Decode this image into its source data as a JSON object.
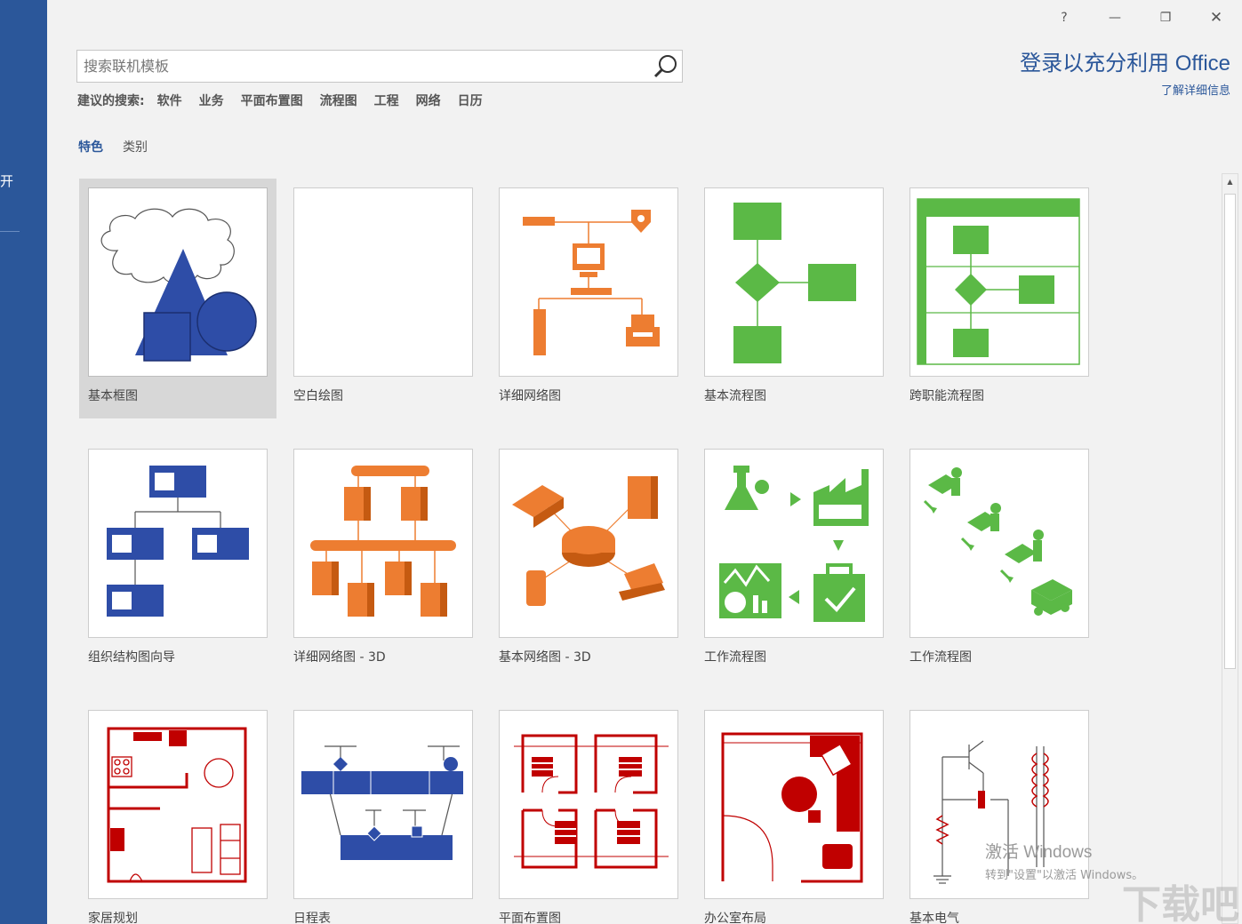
{
  "sidebar": {
    "partial_item": "开"
  },
  "window_controls": {
    "help": "?",
    "minimize": "—",
    "restore": "❐",
    "close": "✕"
  },
  "signin": {
    "title": "登录以充分利用 Office",
    "more": "了解详细信息"
  },
  "search": {
    "placeholder": "搜索联机模板"
  },
  "suggested": {
    "label": "建议的搜索:",
    "items": [
      "软件",
      "业务",
      "平面布置图",
      "流程图",
      "工程",
      "网络",
      "日历"
    ]
  },
  "tabs": [
    {
      "label": "特色",
      "active": true
    },
    {
      "label": "类别",
      "active": false
    }
  ],
  "templates": [
    {
      "label": "基本框图",
      "icon": "basic-shapes-icon",
      "selected": true
    },
    {
      "label": "空白绘图",
      "icon": "blank-icon"
    },
    {
      "label": "详细网络图",
      "icon": "detailed-network-icon"
    },
    {
      "label": "基本流程图",
      "icon": "basic-flowchart-icon"
    },
    {
      "label": "跨职能流程图",
      "icon": "cross-functional-flowchart-icon"
    },
    {
      "label": "组织结构图向导",
      "icon": "org-chart-icon"
    },
    {
      "label": "详细网络图 - 3D",
      "icon": "detailed-network-3d-icon"
    },
    {
      "label": "基本网络图 - 3D",
      "icon": "basic-network-3d-icon"
    },
    {
      "label": "工作流程图",
      "icon": "workflow-icon"
    },
    {
      "label": "工作流程图",
      "icon": "workflow-3d-icon"
    },
    {
      "label": "家居规划",
      "icon": "home-plan-icon"
    },
    {
      "label": "日程表",
      "icon": "timeline-icon"
    },
    {
      "label": "平面布置图",
      "icon": "floor-plan-icon"
    },
    {
      "label": "办公室布局",
      "icon": "office-layout-icon"
    },
    {
      "label": "基本电气",
      "icon": "basic-electrical-icon"
    }
  ],
  "colors": {
    "accent": "#2b579a",
    "orange": "#ed7d31",
    "green": "#5bb946",
    "red": "#c00000"
  },
  "watermark": {
    "line1": "激活 Windows",
    "line2": "转到\"设置\"以激活 Windows。",
    "logo": "下载吧"
  }
}
